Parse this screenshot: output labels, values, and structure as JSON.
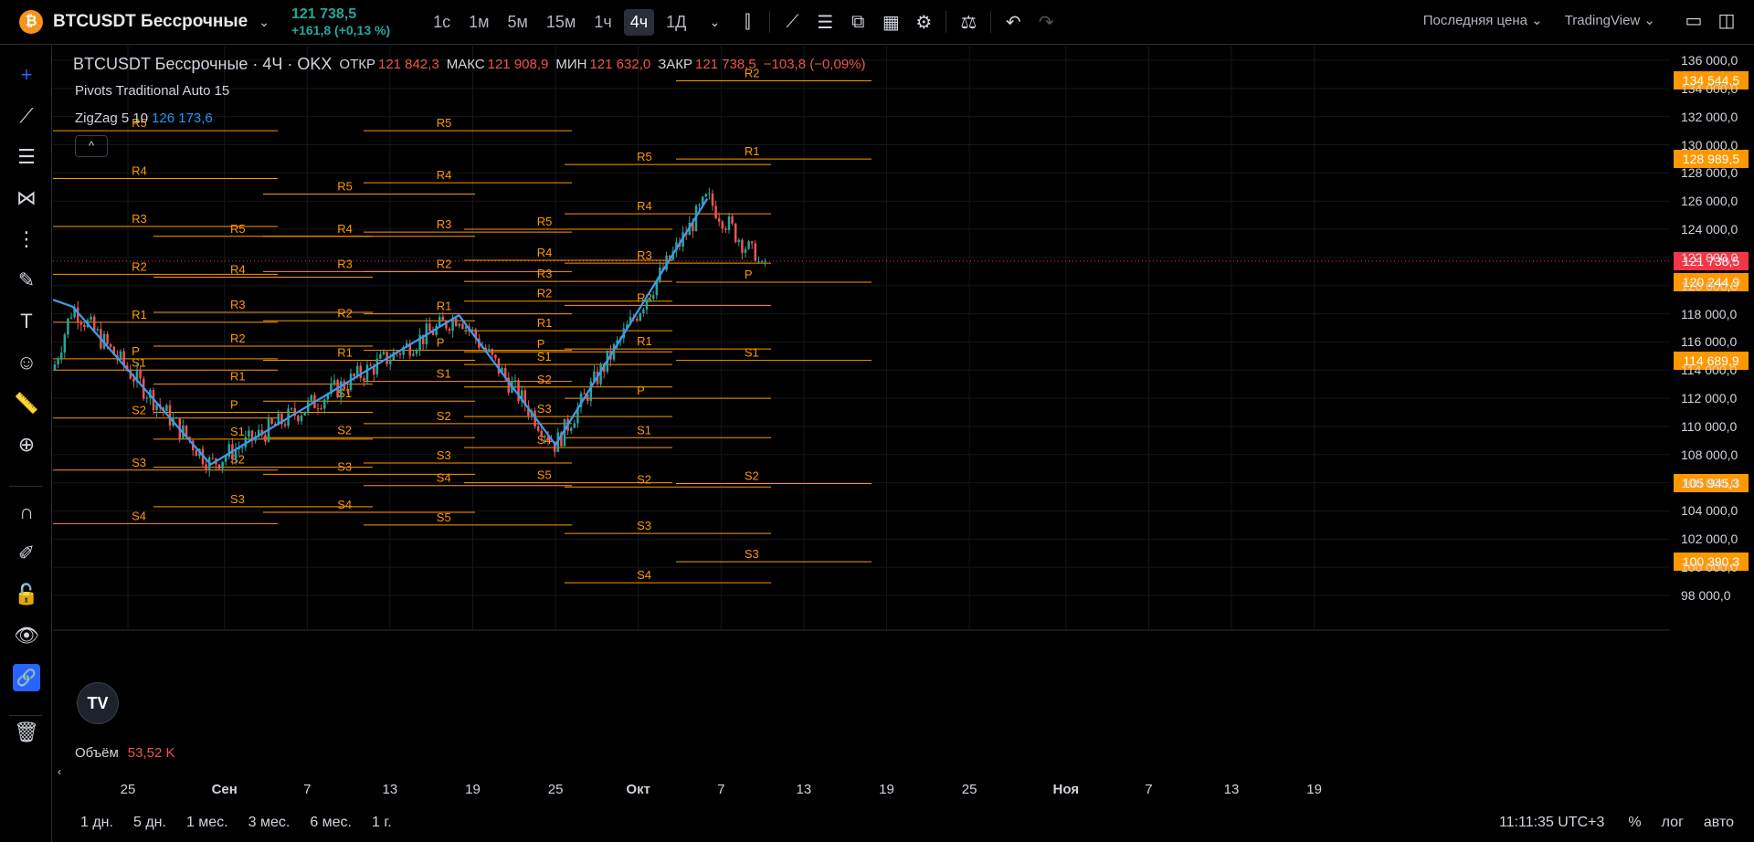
{
  "topbar": {
    "symbol": "BTCUSDT Бессрочные",
    "price": "121 738,5",
    "change": "+161,8 (+0,13 %)",
    "timeframes": [
      "1с",
      "1м",
      "5м",
      "15м",
      "1ч",
      "4ч",
      "1Д"
    ],
    "active_timeframe": "4ч",
    "price_type": "Последняя цена",
    "source": "TradingView"
  },
  "legend": {
    "symbol_line": "BTCUSDT Бессрочные · 4Ч · OKX",
    "open_label": "ОТКР",
    "open": "121 842,3",
    "high_label": "МАКС",
    "high": "121 908,9",
    "low_label": "МИН",
    "low": "121 632,0",
    "close_label": "ЗАКР",
    "close": "121 738,5",
    "diff": "−103,8 (−0,09%)",
    "pivots": "Pivots Traditional Auto 15",
    "zigzag_label": "ZigZag 5 10",
    "zigzag_value": "126 173,6",
    "collapse": "^"
  },
  "volume": {
    "label": "Объём",
    "value": "53,52 K"
  },
  "price_axis": {
    "ticks": [
      "136 000,0",
      "134 000,0",
      "132 000,0",
      "130 000,0",
      "128 000,0",
      "126 000,0",
      "124 000,0",
      "122 000,0",
      "120 000,0",
      "118 000,0",
      "116 000,0",
      "114 000,0",
      "112 000,0",
      "110 000,0",
      "108 000,0",
      "106 000,0",
      "104 000,0",
      "102 000,0",
      "100 000,0",
      "98 000,0"
    ],
    "tags": [
      {
        "value": "134 544,5",
        "color": "#ff9800"
      },
      {
        "value": "128 989,5",
        "color": "#ff9800"
      },
      {
        "value": "121 738,5",
        "color": "#f23645"
      },
      {
        "value": "120 244,9",
        "color": "#ff9800"
      },
      {
        "value": "114 689,9",
        "color": "#ff9800"
      },
      {
        "value": "105 945,3",
        "color": "#ff9800"
      },
      {
        "value": "100 390,3",
        "color": "#ff9800"
      }
    ]
  },
  "time_axis": [
    "25",
    "Сен",
    "7",
    "13",
    "19",
    "25",
    "Окт",
    "7",
    "13",
    "19",
    "25",
    "Ноя",
    "7",
    "13",
    "19"
  ],
  "bottom": {
    "ranges": [
      "1 дн.",
      "5 дн.",
      "1 мес.",
      "3 мес.",
      "6 мес.",
      "1 г."
    ],
    "clock": "11:11:35 UTC+3",
    "percent": "%",
    "log": "лог",
    "auto": "авто"
  },
  "chart_data": {
    "type": "candlestick",
    "ylim": [
      97000,
      137000
    ],
    "last_price": 121738.5,
    "zigzag_points": [
      {
        "date": "2025-08-21",
        "value": 118500
      },
      {
        "date": "2025-08-31",
        "value": 107300
      },
      {
        "date": "2025-09-18",
        "value": 117900
      },
      {
        "date": "2025-09-25",
        "value": 108700
      },
      {
        "date": "2025-10-06",
        "value": 126173.6
      }
    ],
    "pivot_periods": [
      {
        "levels": [
          {
            "name": "R5",
            "value": 131000
          },
          {
            "name": "R4",
            "value": 127600
          },
          {
            "name": "R3",
            "value": 124200
          },
          {
            "name": "R2",
            "value": 120800
          },
          {
            "name": "R1",
            "value": 117400
          },
          {
            "name": "P",
            "value": 114800
          },
          {
            "name": "S1",
            "value": 114000
          },
          {
            "name": "S2",
            "value": 110600
          },
          {
            "name": "S3",
            "value": 106900
          },
          {
            "name": "S4",
            "value": 103100
          }
        ]
      },
      {
        "levels": [
          {
            "name": "R5",
            "value": 123500
          },
          {
            "name": "R4",
            "value": 120600
          },
          {
            "name": "R3",
            "value": 118100
          },
          {
            "name": "R2",
            "value": 115700
          },
          {
            "name": "R1",
            "value": 113000
          },
          {
            "name": "P",
            "value": 111000
          },
          {
            "name": "S1",
            "value": 109100
          },
          {
            "name": "S2",
            "value": 107100
          },
          {
            "name": "S3",
            "value": 104300
          }
        ]
      },
      {
        "levels": [
          {
            "name": "R5",
            "value": 126500
          },
          {
            "name": "R4",
            "value": 123500
          },
          {
            "name": "R3",
            "value": 121000
          },
          {
            "name": "R2",
            "value": 117500
          },
          {
            "name": "R1",
            "value": 114700
          },
          {
            "name": "S1",
            "value": 111800
          },
          {
            "name": "S2",
            "value": 109200
          },
          {
            "name": "S3",
            "value": 106600
          },
          {
            "name": "S4",
            "value": 103900
          }
        ]
      },
      {
        "levels": [
          {
            "name": "R5",
            "value": 131000
          },
          {
            "name": "R4",
            "value": 127300
          },
          {
            "name": "R3",
            "value": 123800
          },
          {
            "name": "R2",
            "value": 121000
          },
          {
            "name": "R1",
            "value": 118000
          },
          {
            "name": "P",
            "value": 115400
          },
          {
            "name": "S1",
            "value": 113200
          },
          {
            "name": "S2",
            "value": 110200
          },
          {
            "name": "S3",
            "value": 107400
          },
          {
            "name": "S4",
            "value": 105800
          },
          {
            "name": "S5",
            "value": 103000
          }
        ]
      },
      {
        "levels": [
          {
            "name": "R5",
            "value": 124000
          },
          {
            "name": "R4",
            "value": 121800
          },
          {
            "name": "R3",
            "value": 120300
          },
          {
            "name": "R2",
            "value": 118900
          },
          {
            "name": "R1",
            "value": 116800
          },
          {
            "name": "P",
            "value": 115300
          },
          {
            "name": "S1",
            "value": 114400
          },
          {
            "name": "S2",
            "value": 112800
          },
          {
            "name": "S3",
            "value": 110700
          },
          {
            "name": "S4",
            "value": 108500
          },
          {
            "name": "S5",
            "value": 106000
          }
        ]
      },
      {
        "levels": [
          {
            "name": "R5",
            "value": 128600
          },
          {
            "name": "R4",
            "value": 125100
          },
          {
            "name": "R3",
            "value": 121600
          },
          {
            "name": "R2",
            "value": 118600
          },
          {
            "name": "R1",
            "value": 115500
          },
          {
            "name": "P",
            "value": 112000
          },
          {
            "name": "S1",
            "value": 109200
          },
          {
            "name": "S2",
            "value": 105700
          },
          {
            "name": "S3",
            "value": 102400
          },
          {
            "name": "S4",
            "value": 98900
          }
        ]
      },
      {
        "levels": [
          {
            "name": "R2",
            "value": 134544.5
          },
          {
            "name": "R1",
            "value": 128989.5
          },
          {
            "name": "P",
            "value": 120244.9
          },
          {
            "name": "S1",
            "value": 114689.9
          },
          {
            "name": "S2",
            "value": 105945.3
          },
          {
            "name": "S3",
            "value": 100390.3
          }
        ]
      }
    ]
  }
}
